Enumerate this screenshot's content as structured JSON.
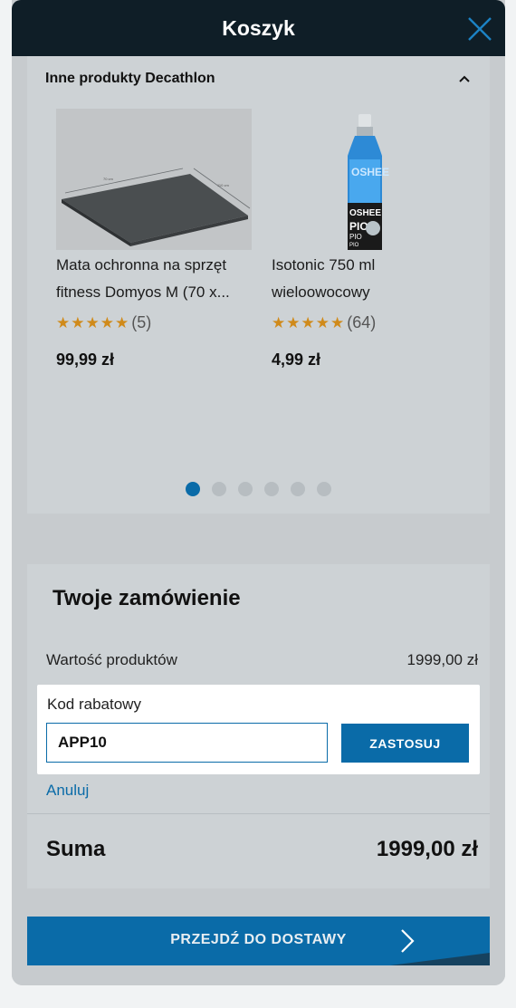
{
  "header": {
    "title": "Koszyk"
  },
  "other_products": {
    "heading": "Inne produkty Decathlon",
    "items": [
      {
        "name_line1": "Mata ochronna na sprzęt",
        "name_line2": "fitness Domyos M (70 x...",
        "rating_count": "(5)",
        "price": "99,99 zł",
        "stars": 5
      },
      {
        "name_line1": "Isotonic 750 ml",
        "name_line2": "wieloowocowy",
        "rating_count": "(64)",
        "price": "4,99 zł",
        "stars": 5
      }
    ],
    "mat_labels": {
      "w": "70 cm",
      "l": "110 cm"
    },
    "bottle_labels": {
      "brand": "OSHEE",
      "sub1": "PIO",
      "sub2": "PIO",
      "sub3": "PIO"
    },
    "carousel": {
      "pages": 6,
      "active": 0
    }
  },
  "order": {
    "title": "Twoje zamówienie",
    "products_value_label": "Wartość produktów",
    "products_value": "1999,00 zł",
    "promo": {
      "label": "Kod rabatowy",
      "value": "APP10",
      "apply_label": "ZASTOSUJ"
    },
    "cancel_label": "Anuluj",
    "total_label": "Suma",
    "total_value": "1999,00 zł"
  },
  "cta": {
    "label": "PRZEJDŹ DO DOSTAWY"
  },
  "colors": {
    "accent": "#0a6ba8",
    "header": "#0f1e27",
    "star": "#d08a1a"
  }
}
